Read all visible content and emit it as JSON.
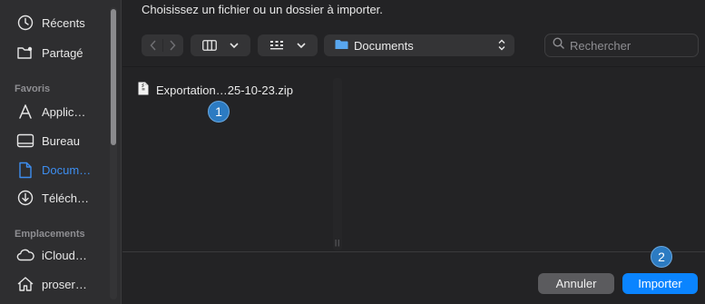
{
  "dialog": {
    "title": "Choisissez un fichier ou un dossier à importer."
  },
  "sidebar": {
    "items_top": [
      {
        "label": "Récents",
        "icon": "clock-icon"
      },
      {
        "label": "Partagé",
        "icon": "shared-folder-icon"
      }
    ],
    "favorites_header": "Favoris",
    "favorites": [
      {
        "label": "Applic…",
        "icon": "applications-icon"
      },
      {
        "label": "Bureau",
        "icon": "desktop-icon"
      },
      {
        "label": "Docum…",
        "icon": "document-icon",
        "active": true
      },
      {
        "label": "Téléch…",
        "icon": "download-icon"
      }
    ],
    "locations_header": "Emplacements",
    "locations": [
      {
        "label": "iCloud…",
        "icon": "cloud-icon"
      },
      {
        "label": "proser…",
        "icon": "home-icon"
      }
    ]
  },
  "toolbar": {
    "location": "Documents",
    "search_placeholder": "Rechercher"
  },
  "files": [
    {
      "name": "Exportation…25-10-23.zip",
      "icon": "zip-file-icon"
    }
  ],
  "badges": {
    "file_badge": "1",
    "import_badge": "2"
  },
  "buttons": {
    "cancel": "Annuler",
    "import": "Importer"
  },
  "colors": {
    "accent": "#0a84ff",
    "active_sidebar": "#3d8ef0",
    "badge": "#2c7bc2"
  }
}
